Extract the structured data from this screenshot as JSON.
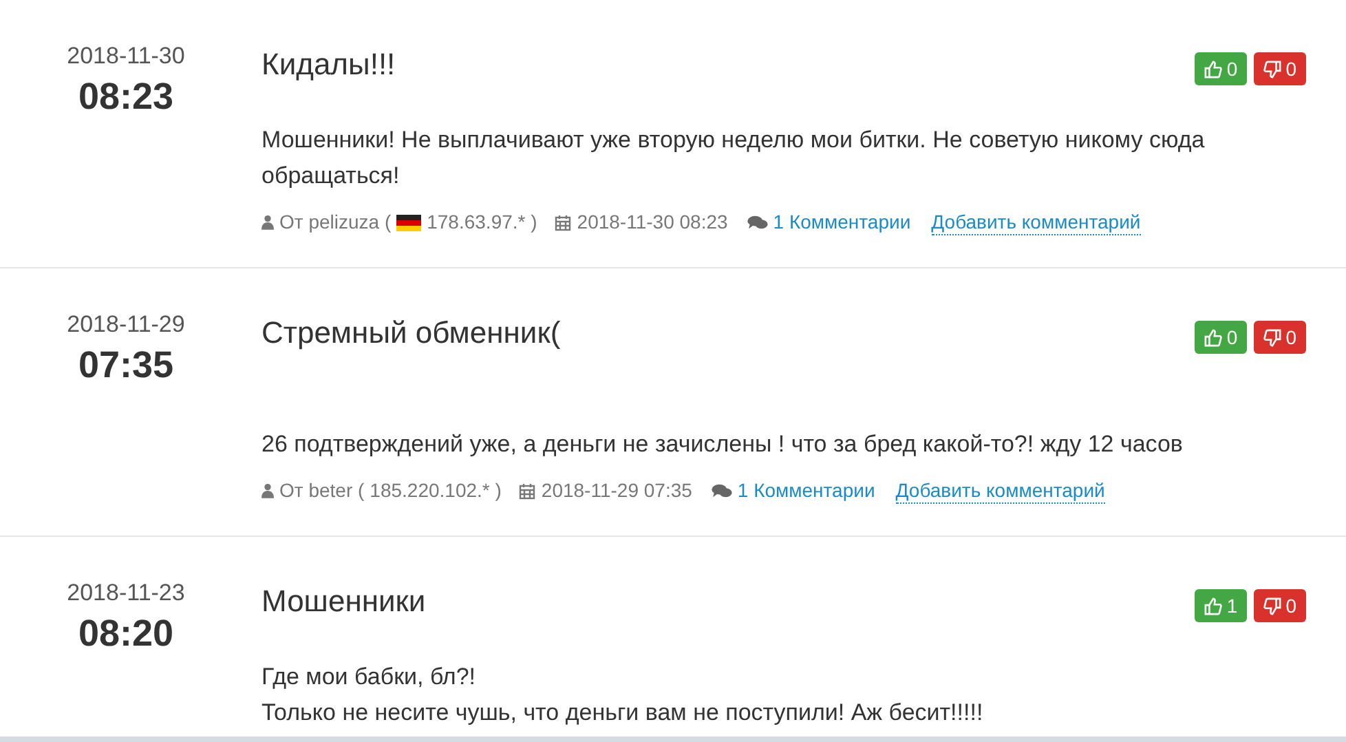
{
  "reviews": [
    {
      "date": "2018-11-30",
      "time": "08:23",
      "title": "Кидалы!!!",
      "likes": "0",
      "dislikes": "0",
      "body": [
        "Мошенники! Не выплачивают уже вторую неделю мои битки. Не советую никому сюда обращаться!"
      ],
      "meta": {
        "author": "От pelizuza (",
        "has_flag": true,
        "ip": "178.63.97.* )",
        "datetime": "2018-11-30 08:23",
        "comments": "1 Комментарии",
        "add_comment": "Добавить комментарий"
      }
    },
    {
      "date": "2018-11-29",
      "time": "07:35",
      "title": "Стремный обменник(",
      "likes": "0",
      "dislikes": "0",
      "body": [
        "26 подтверждений уже, а деньги не зачислены ! что за бред какой-то?! жду 12 часов"
      ],
      "meta": {
        "author": "От beter (",
        "has_flag": false,
        "ip": "185.220.102.* )",
        "datetime": "2018-11-29 07:35",
        "comments": "1 Комментарии",
        "add_comment": "Добавить комментарий"
      }
    },
    {
      "date": "2018-11-23",
      "time": "08:20",
      "title": "Мошенники",
      "likes": "1",
      "dislikes": "0",
      "body": [
        "Где мои бабки, бл?!",
        "Только не несите чушь, что деньги вам не поступили! Аж бесит!!!!!"
      ]
    }
  ]
}
